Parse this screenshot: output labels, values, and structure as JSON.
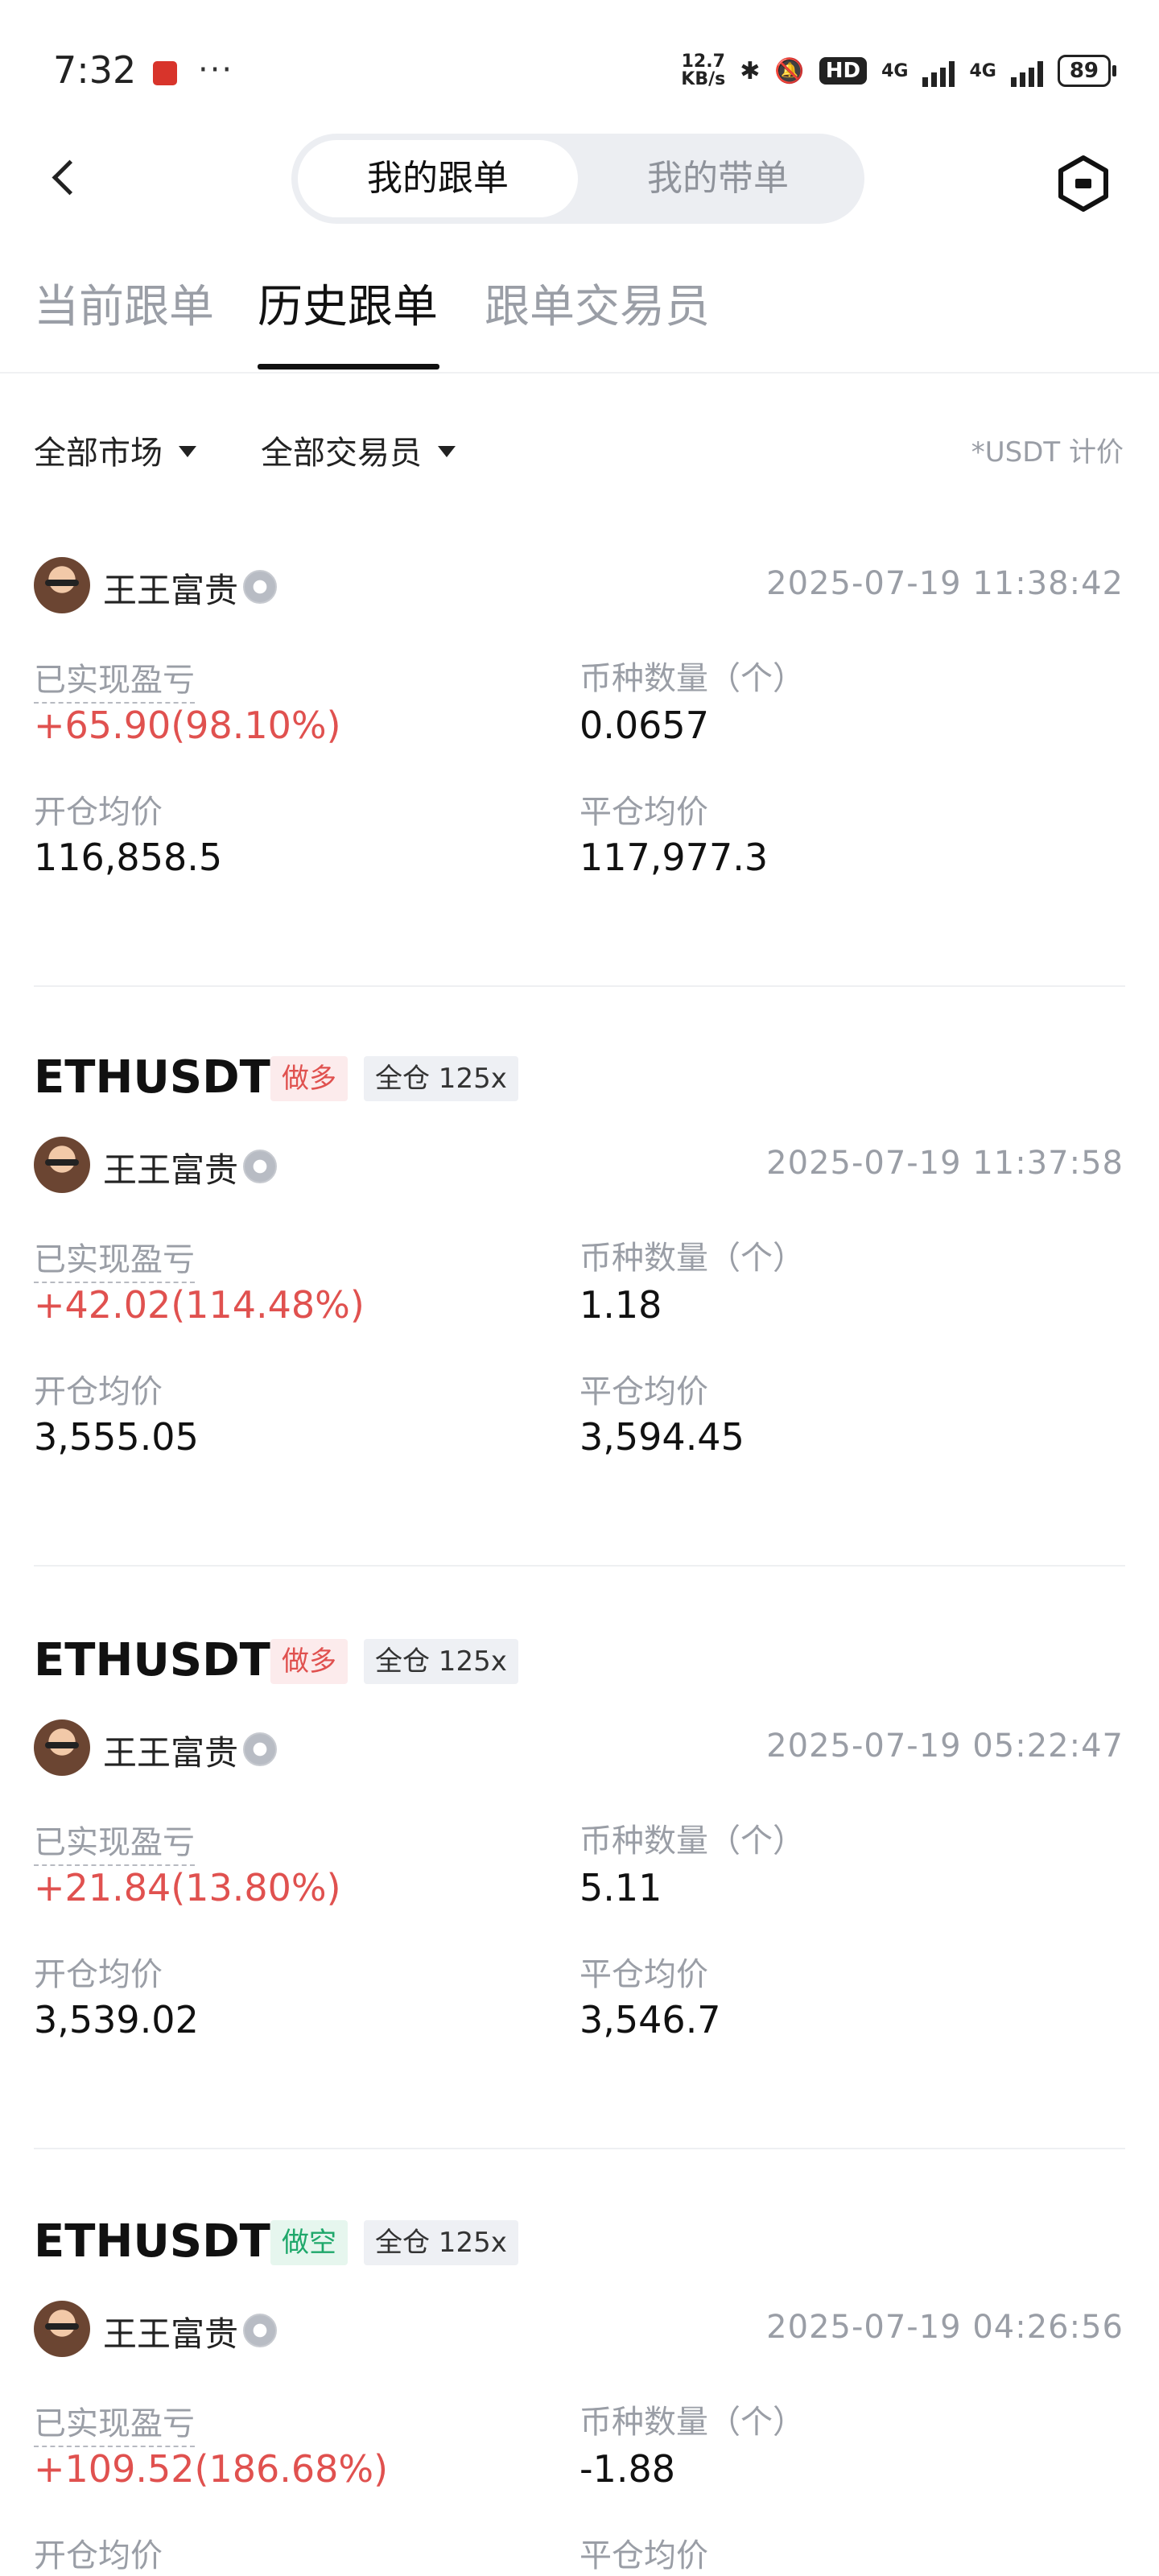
{
  "status_bar": {
    "time": "7:32",
    "more": "···",
    "net_speed_value": "12.7",
    "net_speed_unit": "KB/s",
    "hd_label": "HD",
    "network_1": "4G",
    "network_2": "4G",
    "battery": "89"
  },
  "header": {
    "segments": [
      "我的跟单",
      "我的带单"
    ],
    "active_segment": "我的跟单"
  },
  "tabs": [
    "当前跟单",
    "历史跟单",
    "跟单交易员"
  ],
  "active_tab": "历史跟单",
  "filters": {
    "market": "全部市场",
    "trader": "全部交易员",
    "pricing_note": "*USDT 计价"
  },
  "labels": {
    "realized_pnl": "已实现盈亏",
    "quantity": "币种数量（个）",
    "open_avg": "开仓均价",
    "close_avg": "平仓均价"
  },
  "records": [
    {
      "symbol": "",
      "side": "",
      "margin": "",
      "trader": "王王富贵",
      "time": "2025-07-19 11:38:42",
      "pnl": "+65.90(98.10%)",
      "quantity": "0.0657",
      "open_avg": "116,858.5",
      "close_avg": "117,977.3"
    },
    {
      "symbol": "ETHUSDT",
      "side": "做多",
      "margin": "全仓 125x",
      "trader": "王王富贵",
      "time": "2025-07-19 11:37:58",
      "pnl": "+42.02(114.48%)",
      "quantity": "1.18",
      "open_avg": "3,555.05",
      "close_avg": "3,594.45"
    },
    {
      "symbol": "ETHUSDT",
      "side": "做多",
      "margin": "全仓 125x",
      "trader": "王王富贵",
      "time": "2025-07-19 05:22:47",
      "pnl": "+21.84(13.80%)",
      "quantity": "5.11",
      "open_avg": "3,539.02",
      "close_avg": "3,546.7"
    },
    {
      "symbol": "ETHUSDT",
      "side": "做空",
      "margin": "全仓 125x",
      "trader": "王王富贵",
      "time": "2025-07-19 04:26:56",
      "pnl": "+109.52(186.68%)",
      "quantity": "-1.88",
      "open_avg": "",
      "close_avg": ""
    }
  ]
}
